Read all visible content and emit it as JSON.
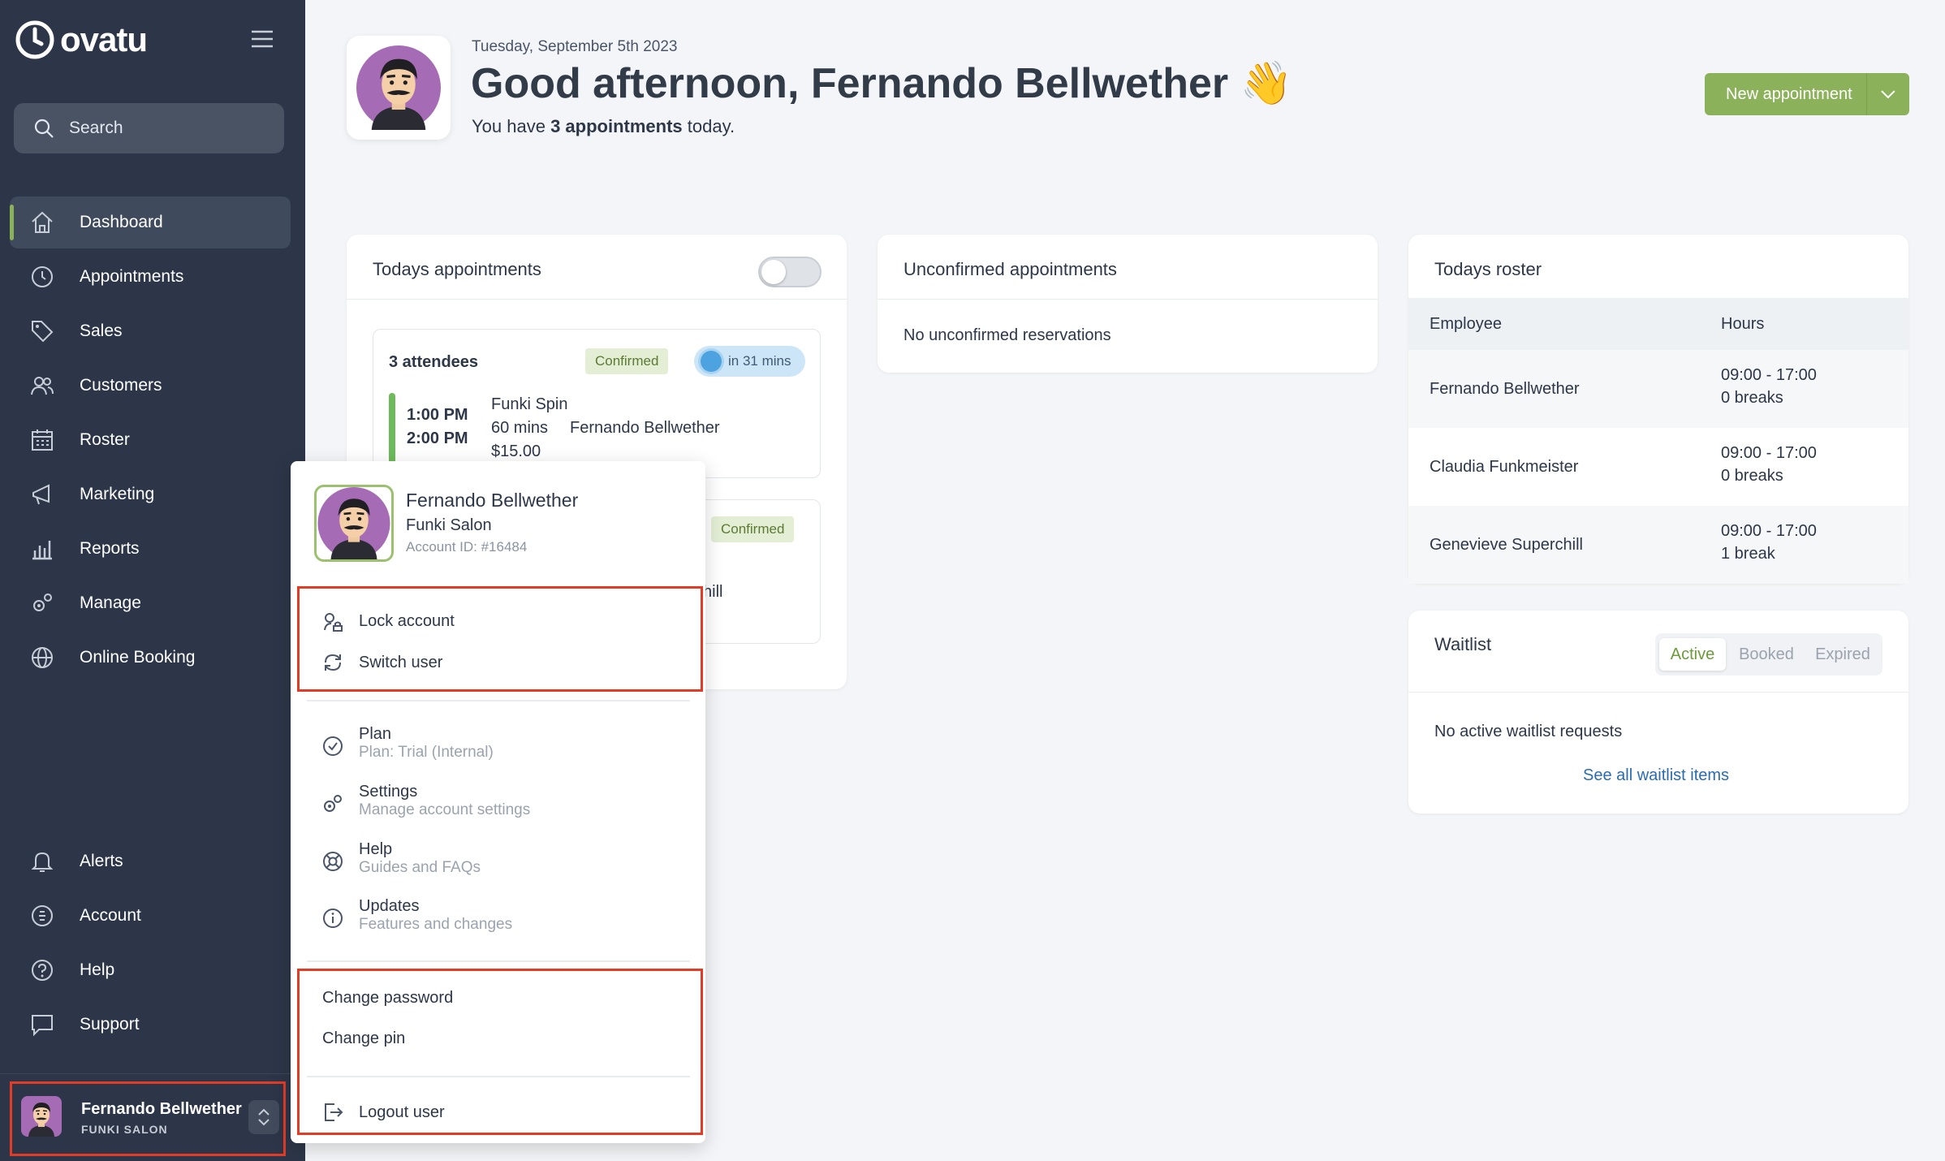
{
  "app": {
    "brand": "ovatu",
    "accent": "#8bb15a",
    "sidebar_bg": "#2c3648"
  },
  "sidebar": {
    "search_label": "Search",
    "items": [
      {
        "label": "Dashboard",
        "icon": "home-icon",
        "active": true
      },
      {
        "label": "Appointments",
        "icon": "clock-icon"
      },
      {
        "label": "Sales",
        "icon": "tag-icon"
      },
      {
        "label": "Customers",
        "icon": "users-icon"
      },
      {
        "label": "Roster",
        "icon": "calendar-icon"
      },
      {
        "label": "Marketing",
        "icon": "megaphone-icon"
      },
      {
        "label": "Reports",
        "icon": "bar-chart-icon"
      },
      {
        "label": "Manage",
        "icon": "gears-icon"
      },
      {
        "label": "Online Booking",
        "icon": "globe-icon"
      }
    ],
    "bottom_items": [
      {
        "label": "Alerts",
        "icon": "bell-icon"
      },
      {
        "label": "Account",
        "icon": "account-icon"
      },
      {
        "label": "Help",
        "icon": "question-icon"
      },
      {
        "label": "Support",
        "icon": "chat-icon"
      }
    ],
    "user": {
      "name": "Fernando Bellwether",
      "salon": "FUNKI SALON"
    }
  },
  "header": {
    "date": "Tuesday, September 5th 2023",
    "greeting": "Good afternoon, Fernando Bellwether 👋",
    "sub_prefix": "You have ",
    "sub_bold": "3 appointments",
    "sub_suffix": " today.",
    "new_button": "New appointment"
  },
  "todays_appointments": {
    "title": "Todays appointments",
    "appointments": [
      {
        "attendees": "3 attendees",
        "status": "Confirmed",
        "countdown": "in 31 mins",
        "start": "1:00 PM",
        "end": "2:00 PM",
        "service": "Funki Spin",
        "duration": "60 mins",
        "staff": "Fernando Bellwether",
        "price": "$15.00"
      },
      {
        "status": "Confirmed",
        "partial_text": "hill"
      }
    ]
  },
  "unconfirmed": {
    "title": "Unconfirmed appointments",
    "empty": "No unconfirmed reservations"
  },
  "roster": {
    "title": "Todays roster",
    "columns": [
      "Employee",
      "Hours"
    ],
    "rows": [
      {
        "employee": "Fernando Bellwether",
        "hours": "09:00 - 17:00",
        "breaks": "0 breaks"
      },
      {
        "employee": "Claudia Funkmeister",
        "hours": "09:00 - 17:00",
        "breaks": "0 breaks"
      },
      {
        "employee": "Genevieve Superchill",
        "hours": "09:00 - 17:00",
        "breaks": "1 break"
      }
    ]
  },
  "waitlist": {
    "title": "Waitlist",
    "tabs": [
      "Active",
      "Booked",
      "Expired"
    ],
    "active_tab": "Active",
    "empty": "No active waitlist requests",
    "link": "See all waitlist items"
  },
  "user_menu": {
    "name": "Fernando Bellwether",
    "salon": "Funki Salon",
    "account_id": "Account ID: #16484",
    "quick": [
      {
        "label": "Lock account",
        "icon": "lock-icon"
      },
      {
        "label": "Switch user",
        "icon": "refresh-icon"
      }
    ],
    "links": [
      {
        "title": "Plan",
        "sub": "Plan: Trial (Internal)",
        "icon": "check-circle-icon"
      },
      {
        "title": "Settings",
        "sub": "Manage account settings",
        "icon": "gears-icon"
      },
      {
        "title": "Help",
        "sub": "Guides and FAQs",
        "icon": "lifebuoy-icon"
      },
      {
        "title": "Updates",
        "sub": "Features and changes",
        "icon": "info-icon"
      }
    ],
    "change_password": "Change password",
    "change_pin": "Change pin",
    "logout": "Logout user"
  }
}
